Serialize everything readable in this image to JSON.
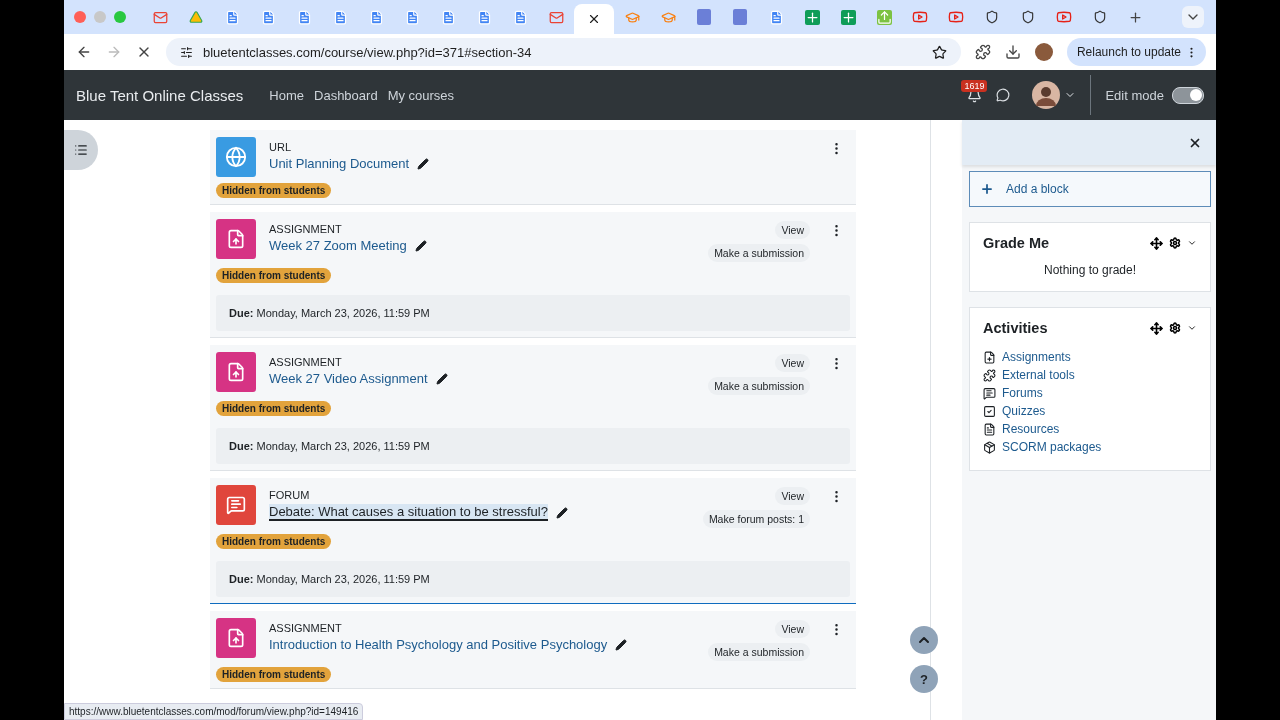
{
  "browser": {
    "tabs": [
      {
        "kind": "mail",
        "selected": false
      },
      {
        "kind": "drive",
        "selected": false
      },
      {
        "kind": "doc",
        "selected": false
      },
      {
        "kind": "doc",
        "selected": false
      },
      {
        "kind": "doc",
        "selected": false
      },
      {
        "kind": "doc",
        "selected": false
      },
      {
        "kind": "doc",
        "selected": false
      },
      {
        "kind": "doc",
        "selected": false
      },
      {
        "kind": "doc",
        "selected": false
      },
      {
        "kind": "doc",
        "selected": false
      },
      {
        "kind": "doc",
        "selected": false
      },
      {
        "kind": "mail",
        "selected": false
      },
      {
        "selected": true
      },
      {
        "kind": "moodle",
        "selected": false
      },
      {
        "kind": "moodle",
        "selected": false
      },
      {
        "kind": "badge",
        "selected": false
      },
      {
        "kind": "badge",
        "selected": false
      },
      {
        "kind": "doc",
        "selected": false
      },
      {
        "kind": "sheet",
        "selected": false
      },
      {
        "kind": "sheet",
        "selected": false
      },
      {
        "kind": "upload",
        "selected": false
      },
      {
        "kind": "video",
        "selected": false
      },
      {
        "kind": "video",
        "selected": false
      },
      {
        "kind": "shield",
        "selected": false
      },
      {
        "kind": "shield",
        "selected": false
      },
      {
        "kind": "video",
        "selected": false
      },
      {
        "kind": "shield",
        "selected": false
      }
    ],
    "address": "bluetentclasses.com/course/view.php?id=371#section-34",
    "relaunch_button": "Relaunch to update"
  },
  "navbar": {
    "brand": "Blue Tent Online Classes",
    "links": [
      "Home",
      "Dashboard",
      "My courses"
    ],
    "notification_count": "1619",
    "edit_mode": {
      "label": "Edit mode",
      "on": true
    }
  },
  "activities": [
    {
      "kind": "url",
      "type": "URL",
      "title": "Unit Planning Document",
      "highlighted": false,
      "focused": false,
      "badge": "Hidden from students"
    },
    {
      "kind": "assignment",
      "type": "ASSIGNMENT",
      "title": "Week 27 Zoom Meeting",
      "highlighted": false,
      "focused": false,
      "badge": "Hidden from students",
      "actions": [
        "View",
        "Make a submission"
      ],
      "due": "**Due:** Monday, March 23, 2026, 11:59 PM"
    },
    {
      "kind": "assignment",
      "type": "ASSIGNMENT",
      "title": "Week 27 Video Assignment",
      "highlighted": false,
      "focused": false,
      "badge": "Hidden from students",
      "actions": [
        "View",
        "Make a submission"
      ],
      "due": "**Due:** Monday, March 23, 2026, 11:59 PM"
    },
    {
      "kind": "forum",
      "type": "FORUM",
      "title": "Debate: What causes a situation to be stressful?",
      "highlighted": true,
      "focused": true,
      "badge": "Hidden from students",
      "actions": [
        "View",
        "Make forum posts: 1"
      ],
      "due": "**Due:** Monday, March 23, 2026, 11:59 PM"
    },
    {
      "kind": "assignment",
      "type": "ASSIGNMENT",
      "title": "Introduction to Health Psychology and Positive Psychology",
      "highlighted": false,
      "badge": "Hidden from students",
      "actions": [
        "View",
        "Make a submission"
      ]
    }
  ],
  "drawer": {
    "add_block": "Add a block",
    "blocks": [
      {
        "kind": "message",
        "title": "Grade Me",
        "text": "Nothing to grade!"
      },
      {
        "kind": "links",
        "title": "Activities",
        "items": [
          {
            "kind": "assign",
            "label": "Assignments"
          },
          {
            "kind": "external",
            "label": "External tools"
          },
          {
            "kind": "forum",
            "label": "Forums"
          },
          {
            "kind": "quiz",
            "label": "Quizzes"
          },
          {
            "kind": "resource",
            "label": "Resources"
          },
          {
            "kind": "scorm",
            "label": "SCORM packages"
          }
        ]
      }
    ]
  },
  "help_button": "?",
  "status_url": "https://www.bluetentclasses.com/mod/forum/view.php?id=149416"
}
